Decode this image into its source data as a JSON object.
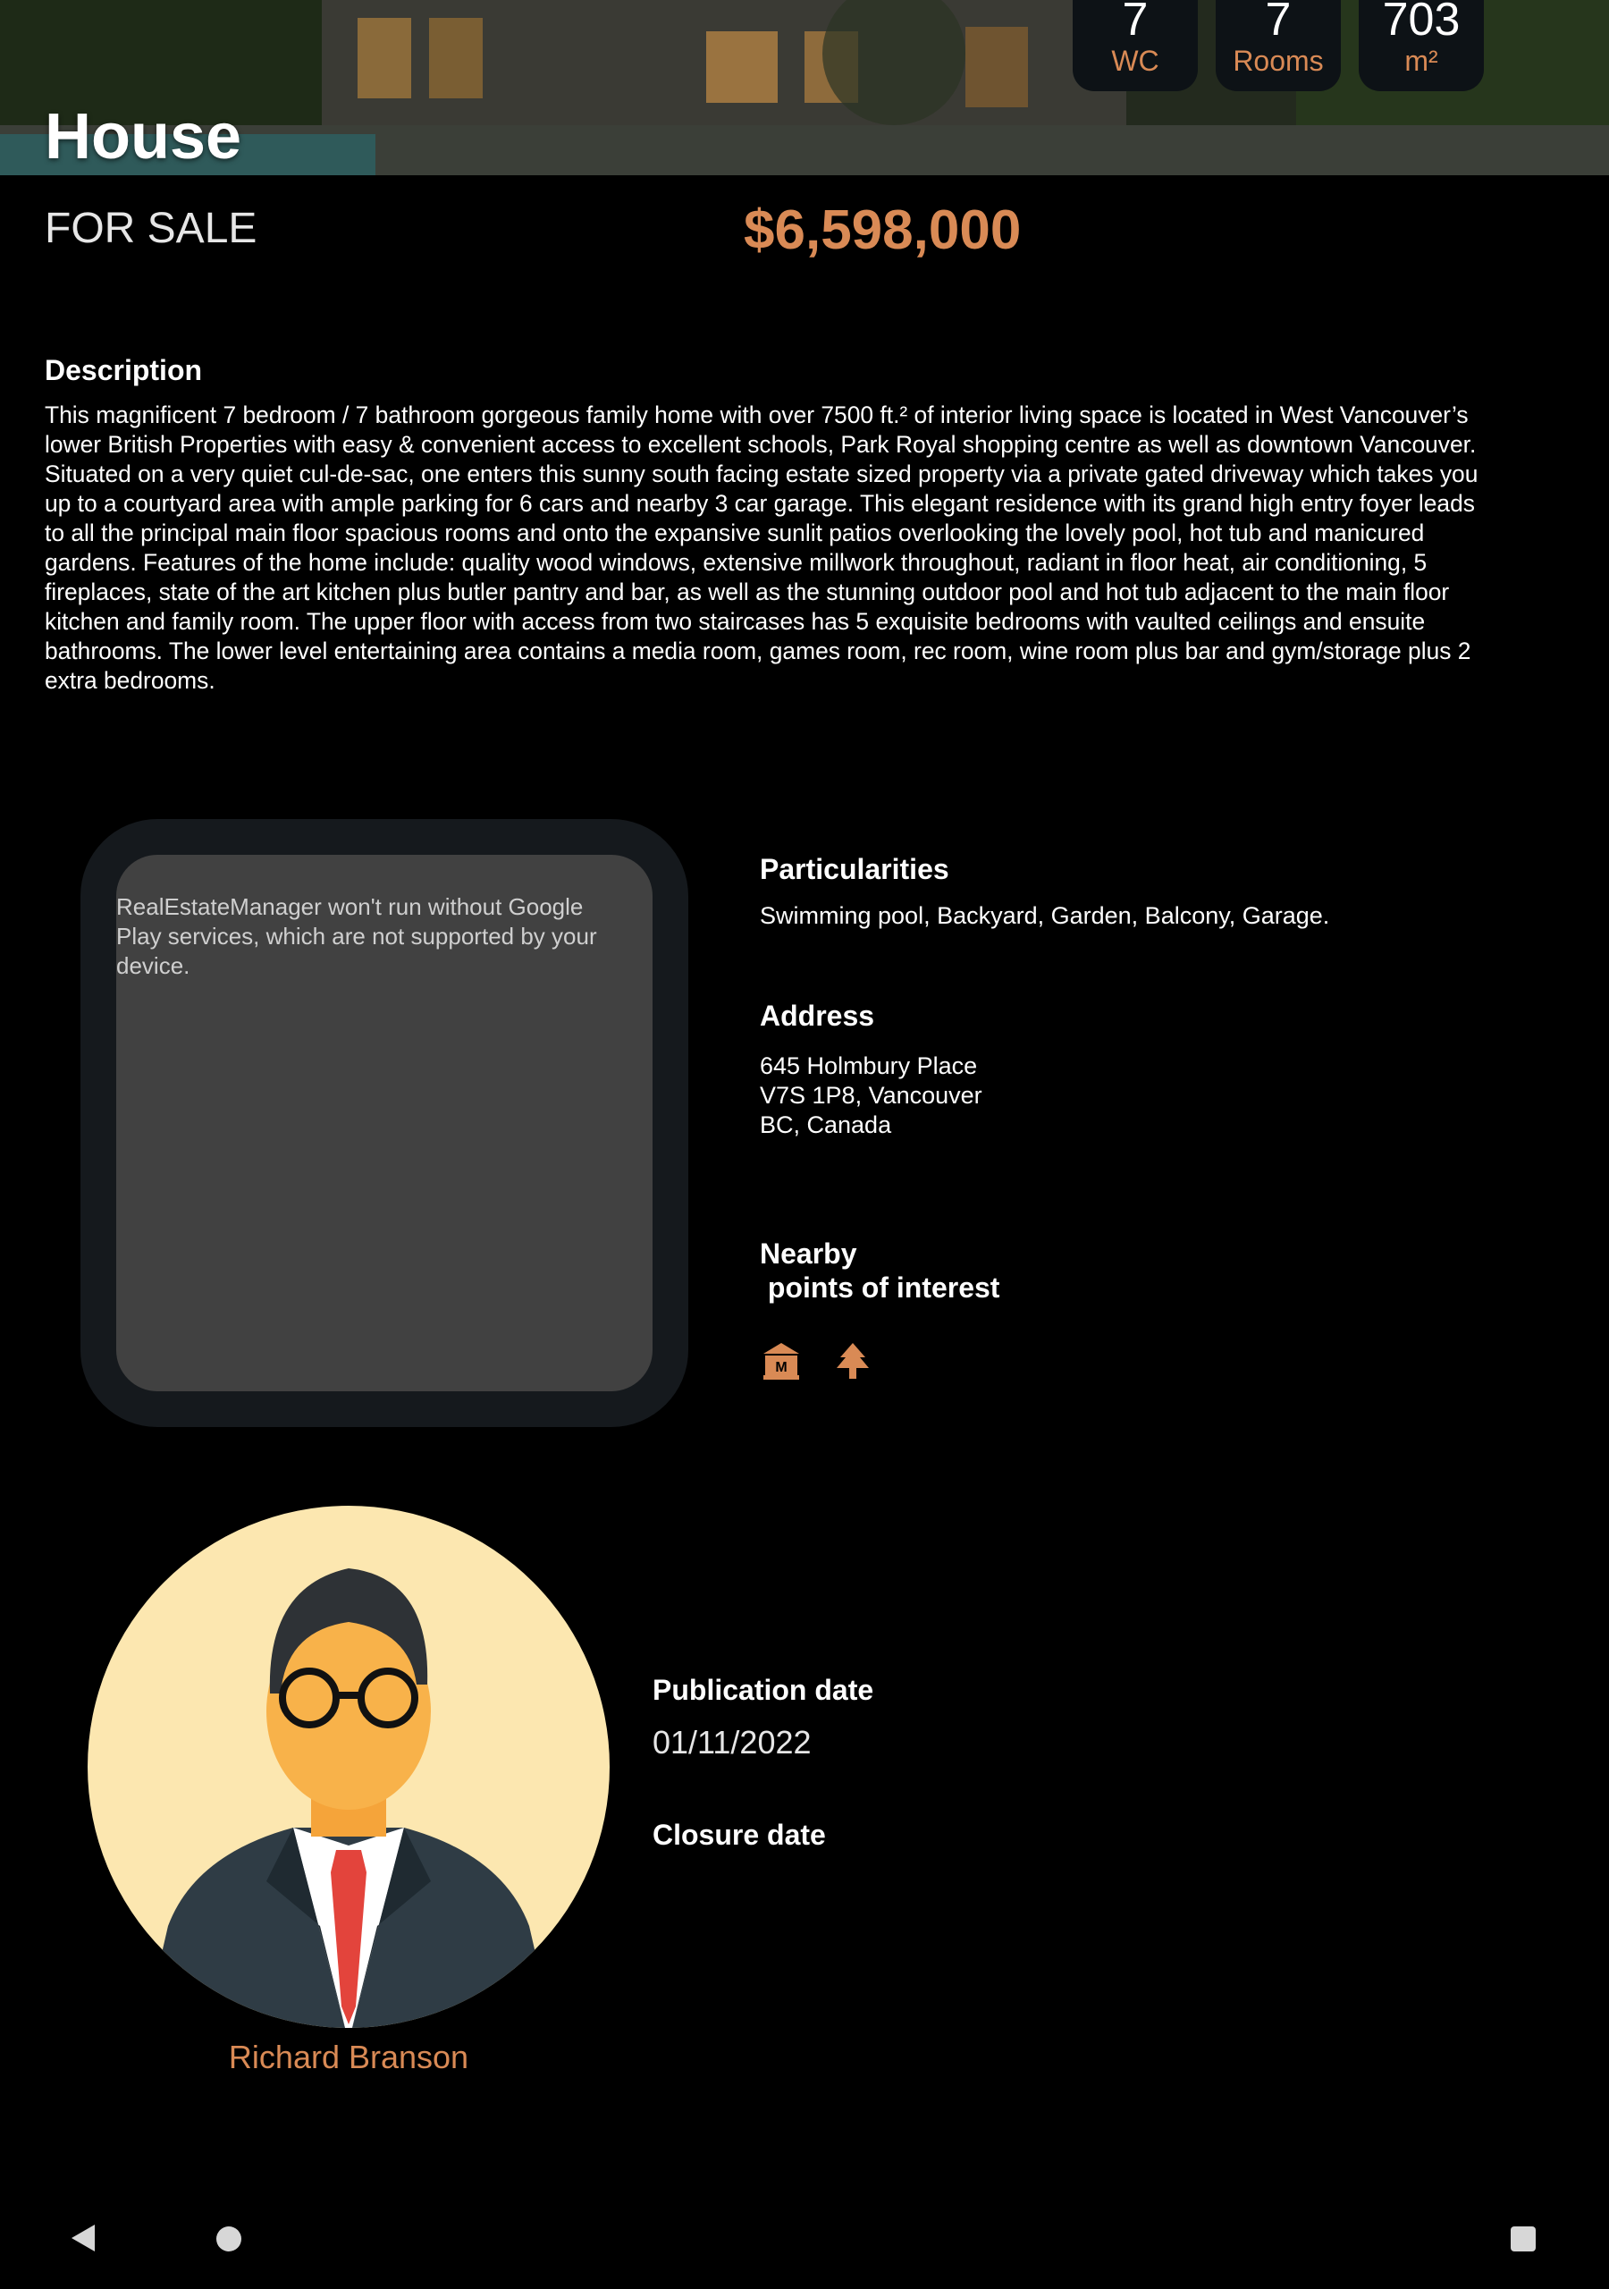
{
  "listing": {
    "type": "House",
    "status": "FOR SALE",
    "price": "$6,598,000"
  },
  "stats": [
    {
      "value": "7",
      "label": "WC"
    },
    {
      "value": "7",
      "label": "Rooms"
    },
    {
      "value": "703",
      "label": "m²"
    }
  ],
  "description": {
    "title": "Description",
    "text": "This magnificent 7 bedroom / 7 bathroom gorgeous family home with over 7500 ft.² of interior living space is located in West Vancouver’s lower British Properties with easy & convenient access to excellent schools, Park Royal shopping centre as well as downtown Vancouver. Situated on a very quiet cul-de-sac, one enters this sunny south facing estate sized property via a private gated driveway which takes you up to a courtyard area with ample parking for 6 cars and nearby 3 car garage. This elegant residence with its grand high entry foyer leads to all the principal main floor spacious rooms and onto the expansive sunlit patios overlooking the lovely pool, hot tub and manicured gardens. Features of the home include: quality wood windows, extensive millwork throughout, radiant in floor heat, air conditioning, 5 fireplaces, state of the art kitchen plus butler pantry and bar, as well as the stunning outdoor pool and hot tub adjacent to the main floor kitchen and family room. The upper floor with access from two staircases has 5 exquisite bedrooms with vaulted ceilings and ensuite bathrooms. The lower level entertaining area contains a media room, games room, rec room, wine room plus bar and gym/storage plus 2 extra bedrooms."
  },
  "map": {
    "message": "RealEstateManager won't run without Google Play services, which are not supported by your device."
  },
  "particularities": {
    "title": "Particularities",
    "text": "Swimming pool, Backyard, Garden, Balcony, Garage."
  },
  "address": {
    "title": "Address",
    "line1": "645 Holmbury Place",
    "line2": "V7S 1P8, Vancouver",
    "line3": "BC, Canada"
  },
  "nearby": {
    "title_line1": "Nearby",
    "title_line2": " points of interest",
    "icons": [
      "museum-icon",
      "park-tree-icon"
    ]
  },
  "agent": {
    "name": "Richard Branson"
  },
  "dates": {
    "publication_title": "Publication date",
    "publication_value": "01/11/2022",
    "closure_title": "Closure date"
  },
  "colors": {
    "accent": "#d98a55",
    "background": "#000000",
    "card": "#15191d",
    "map_placeholder": "#414141"
  }
}
